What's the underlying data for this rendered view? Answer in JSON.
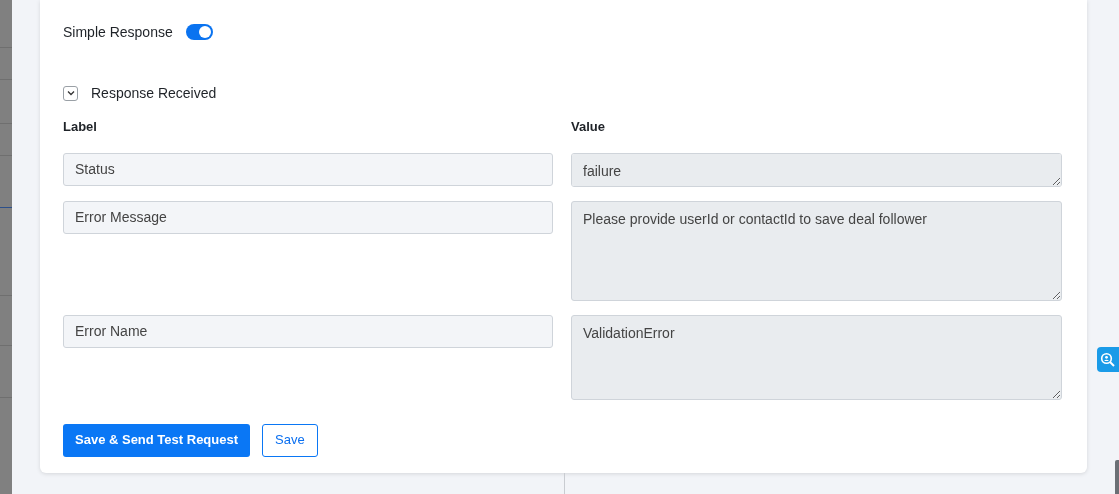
{
  "simple_response": {
    "label": "Simple Response",
    "on": true
  },
  "section": {
    "title": "Response Received",
    "expanded": true
  },
  "table": {
    "columns": [
      "Label",
      "Value"
    ],
    "rows": [
      {
        "label": "Status",
        "value": "failure"
      },
      {
        "label": "Error Message",
        "value": "Please provide userId or contactId to save deal follower"
      },
      {
        "label": "Error Name",
        "value": "ValidationError"
      }
    ]
  },
  "buttons": [
    {
      "label": "Save & Send Test Request",
      "kind": "primary"
    },
    {
      "label": "Save",
      "kind": "outline"
    }
  ]
}
